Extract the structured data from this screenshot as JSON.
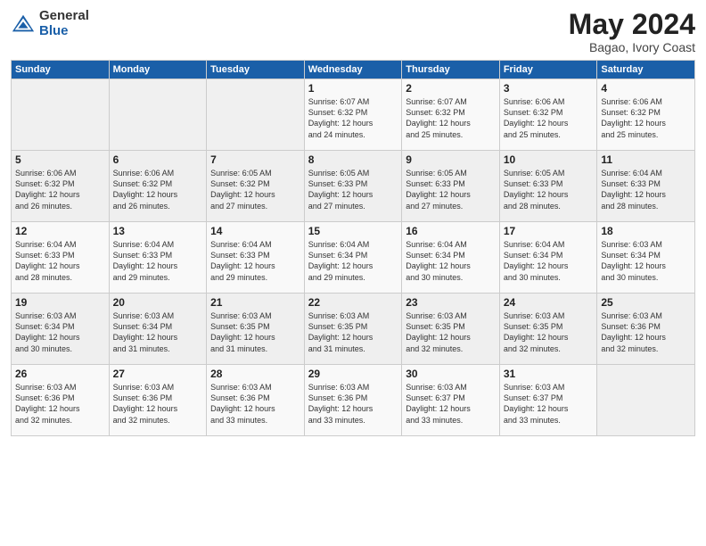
{
  "header": {
    "logo_general": "General",
    "logo_blue": "Blue",
    "title": "May 2024",
    "subtitle": "Bagao, Ivory Coast"
  },
  "weekdays": [
    "Sunday",
    "Monday",
    "Tuesday",
    "Wednesday",
    "Thursday",
    "Friday",
    "Saturday"
  ],
  "weeks": [
    [
      {
        "day": "",
        "info": ""
      },
      {
        "day": "",
        "info": ""
      },
      {
        "day": "",
        "info": ""
      },
      {
        "day": "1",
        "info": "Sunrise: 6:07 AM\nSunset: 6:32 PM\nDaylight: 12 hours\nand 24 minutes."
      },
      {
        "day": "2",
        "info": "Sunrise: 6:07 AM\nSunset: 6:32 PM\nDaylight: 12 hours\nand 25 minutes."
      },
      {
        "day": "3",
        "info": "Sunrise: 6:06 AM\nSunset: 6:32 PM\nDaylight: 12 hours\nand 25 minutes."
      },
      {
        "day": "4",
        "info": "Sunrise: 6:06 AM\nSunset: 6:32 PM\nDaylight: 12 hours\nand 25 minutes."
      }
    ],
    [
      {
        "day": "5",
        "info": "Sunrise: 6:06 AM\nSunset: 6:32 PM\nDaylight: 12 hours\nand 26 minutes."
      },
      {
        "day": "6",
        "info": "Sunrise: 6:06 AM\nSunset: 6:32 PM\nDaylight: 12 hours\nand 26 minutes."
      },
      {
        "day": "7",
        "info": "Sunrise: 6:05 AM\nSunset: 6:32 PM\nDaylight: 12 hours\nand 27 minutes."
      },
      {
        "day": "8",
        "info": "Sunrise: 6:05 AM\nSunset: 6:33 PM\nDaylight: 12 hours\nand 27 minutes."
      },
      {
        "day": "9",
        "info": "Sunrise: 6:05 AM\nSunset: 6:33 PM\nDaylight: 12 hours\nand 27 minutes."
      },
      {
        "day": "10",
        "info": "Sunrise: 6:05 AM\nSunset: 6:33 PM\nDaylight: 12 hours\nand 28 minutes."
      },
      {
        "day": "11",
        "info": "Sunrise: 6:04 AM\nSunset: 6:33 PM\nDaylight: 12 hours\nand 28 minutes."
      }
    ],
    [
      {
        "day": "12",
        "info": "Sunrise: 6:04 AM\nSunset: 6:33 PM\nDaylight: 12 hours\nand 28 minutes."
      },
      {
        "day": "13",
        "info": "Sunrise: 6:04 AM\nSunset: 6:33 PM\nDaylight: 12 hours\nand 29 minutes."
      },
      {
        "day": "14",
        "info": "Sunrise: 6:04 AM\nSunset: 6:33 PM\nDaylight: 12 hours\nand 29 minutes."
      },
      {
        "day": "15",
        "info": "Sunrise: 6:04 AM\nSunset: 6:34 PM\nDaylight: 12 hours\nand 29 minutes."
      },
      {
        "day": "16",
        "info": "Sunrise: 6:04 AM\nSunset: 6:34 PM\nDaylight: 12 hours\nand 30 minutes."
      },
      {
        "day": "17",
        "info": "Sunrise: 6:04 AM\nSunset: 6:34 PM\nDaylight: 12 hours\nand 30 minutes."
      },
      {
        "day": "18",
        "info": "Sunrise: 6:03 AM\nSunset: 6:34 PM\nDaylight: 12 hours\nand 30 minutes."
      }
    ],
    [
      {
        "day": "19",
        "info": "Sunrise: 6:03 AM\nSunset: 6:34 PM\nDaylight: 12 hours\nand 30 minutes."
      },
      {
        "day": "20",
        "info": "Sunrise: 6:03 AM\nSunset: 6:34 PM\nDaylight: 12 hours\nand 31 minutes."
      },
      {
        "day": "21",
        "info": "Sunrise: 6:03 AM\nSunset: 6:35 PM\nDaylight: 12 hours\nand 31 minutes."
      },
      {
        "day": "22",
        "info": "Sunrise: 6:03 AM\nSunset: 6:35 PM\nDaylight: 12 hours\nand 31 minutes."
      },
      {
        "day": "23",
        "info": "Sunrise: 6:03 AM\nSunset: 6:35 PM\nDaylight: 12 hours\nand 32 minutes."
      },
      {
        "day": "24",
        "info": "Sunrise: 6:03 AM\nSunset: 6:35 PM\nDaylight: 12 hours\nand 32 minutes."
      },
      {
        "day": "25",
        "info": "Sunrise: 6:03 AM\nSunset: 6:36 PM\nDaylight: 12 hours\nand 32 minutes."
      }
    ],
    [
      {
        "day": "26",
        "info": "Sunrise: 6:03 AM\nSunset: 6:36 PM\nDaylight: 12 hours\nand 32 minutes."
      },
      {
        "day": "27",
        "info": "Sunrise: 6:03 AM\nSunset: 6:36 PM\nDaylight: 12 hours\nand 32 minutes."
      },
      {
        "day": "28",
        "info": "Sunrise: 6:03 AM\nSunset: 6:36 PM\nDaylight: 12 hours\nand 33 minutes."
      },
      {
        "day": "29",
        "info": "Sunrise: 6:03 AM\nSunset: 6:36 PM\nDaylight: 12 hours\nand 33 minutes."
      },
      {
        "day": "30",
        "info": "Sunrise: 6:03 AM\nSunset: 6:37 PM\nDaylight: 12 hours\nand 33 minutes."
      },
      {
        "day": "31",
        "info": "Sunrise: 6:03 AM\nSunset: 6:37 PM\nDaylight: 12 hours\nand 33 minutes."
      },
      {
        "day": "",
        "info": ""
      }
    ]
  ]
}
